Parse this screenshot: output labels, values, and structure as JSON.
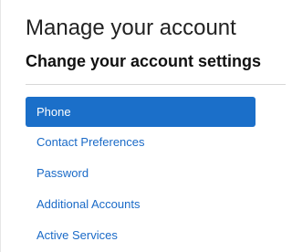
{
  "header": {
    "title": "Manage your account",
    "subtitle": "Change your account settings"
  },
  "nav": {
    "items": [
      {
        "label": "Phone",
        "active": true
      },
      {
        "label": "Contact Preferences",
        "active": false
      },
      {
        "label": "Password",
        "active": false
      },
      {
        "label": "Additional Accounts",
        "active": false
      },
      {
        "label": "Active Services",
        "active": false
      }
    ]
  },
  "colors": {
    "accent": "#1b6fc9",
    "link": "#1a6ac7"
  }
}
